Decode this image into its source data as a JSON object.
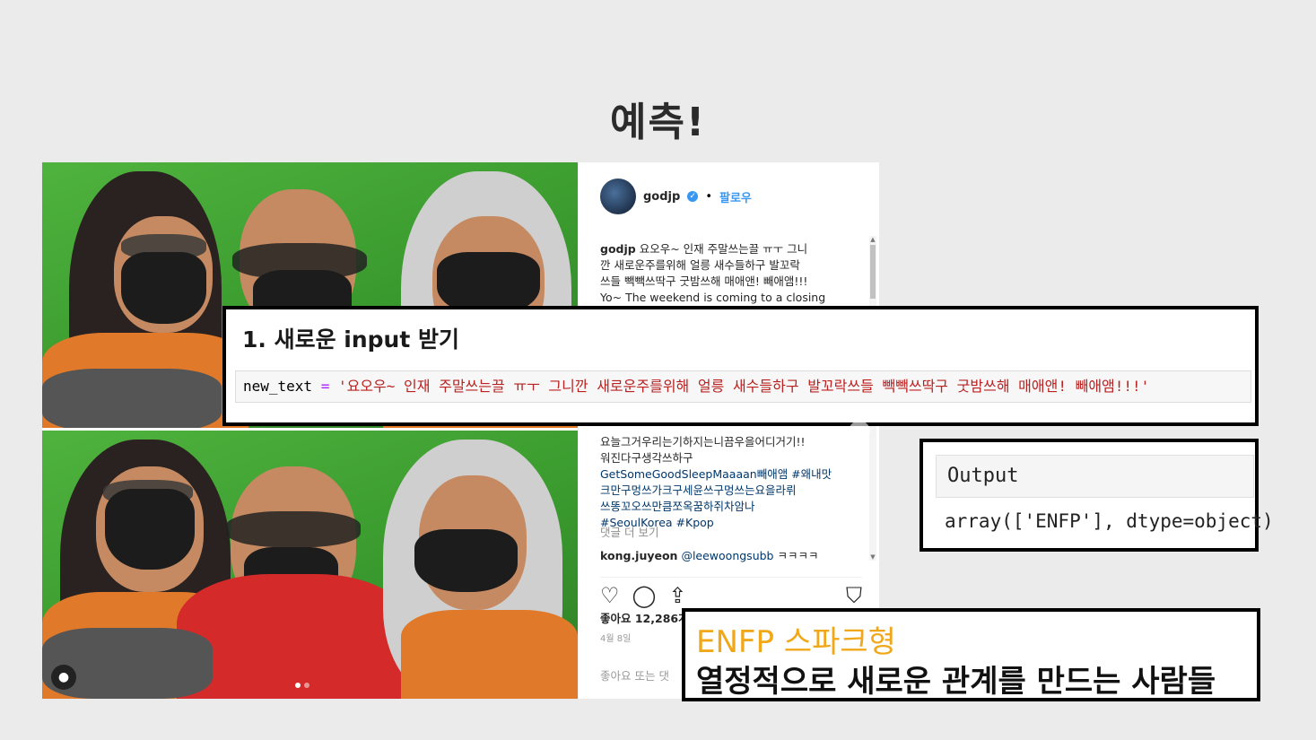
{
  "slide": {
    "title": "예측!"
  },
  "post": {
    "username": "godjp",
    "follow_label": "팔로우",
    "caption_ko_lines": [
      "요오우~ 인재 주말쓰는끌 ㅠㅜ 그니",
      "깐 새로운주를위해 얼릉 새수들하구 발꼬락",
      "쓰들 빽빽쓰딱구 굿밤쓰해 매애앤! 빼애앰!!!"
    ],
    "caption_en": "Yo~ The weekend is coming to a closing",
    "hashtag_lines": [
      "요늘그거우리는기하지는니끔우을어디거기!!",
      "워진다구생각쓰하구",
      "GetSomeGoodSleepMaaaan빼애앰 #왜내맛",
      "크만구멍쓰가크구세윤쓰구멍쓰는요을라뤼",
      "쓰똥꼬오쓰만큼쪼옥꿈하쥐차암나",
      "#SeoulKorea #Kpop"
    ],
    "more_comments": "댓글 더 보기",
    "comment": {
      "user": "kong.juyeon",
      "mention": "@leewoongsubb",
      "text": "ㅋㅋㅋㅋ"
    },
    "likes": "좋아요 12,286개",
    "date": "4월 8일",
    "add_comment": "좋아요 또는 댓"
  },
  "input_box": {
    "heading": "1. 새로운 input 받기",
    "var": "new_text",
    "op": "=",
    "string": "'요오우~ 인재 주말쓰는끌 ㅠㅜ 그니깐 새로운주를위해 얼릉 새수들하구 발꼬락쓰들 빽빽쓰딱구 굿밤쓰해 매애앤! 빼애앰!!!'"
  },
  "output_box": {
    "label": "Output",
    "value": "array(['ENFP'], dtype=object)"
  },
  "result": {
    "type": "ENFP 스파크형",
    "desc": "열정적으로 새로운 관계를 만드는 사람들"
  },
  "icons": {
    "like": "heart-icon",
    "comment": "comment-icon",
    "share": "share-icon",
    "bookmark": "bookmark-icon",
    "verified": "verified-badge-icon",
    "next": "chevron-right-icon",
    "user": "user-tag-icon"
  }
}
